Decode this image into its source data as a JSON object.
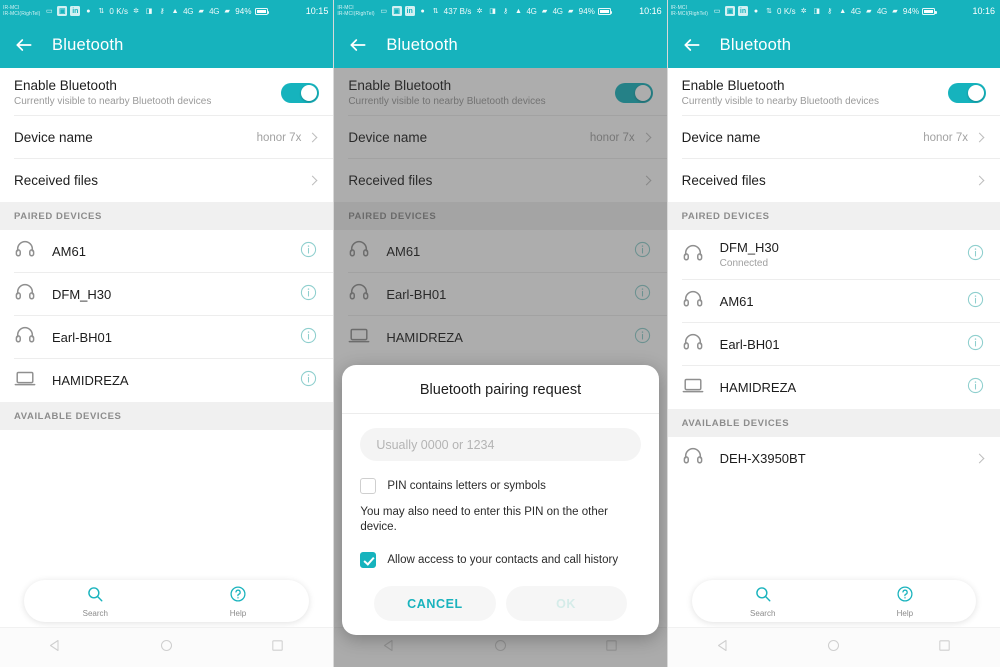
{
  "panels": [
    {
      "id": "panel-paired-list",
      "status": {
        "carrier_line1": "IR-MCI",
        "carrier_line2": "IR-MCI(RighTel)",
        "speed": "0 K/s",
        "battery": "94%",
        "time": "10:15",
        "signal_1": "4G",
        "signal_2": "4G"
      },
      "appbar": {
        "title": "Bluetooth",
        "back_icon": "back-arrow-icon"
      },
      "enable": {
        "title": "Enable Bluetooth",
        "subtitle": "Currently visible to nearby Bluetooth devices",
        "toggle_on": true
      },
      "device_name": {
        "label": "Device name",
        "value": "honor 7x"
      },
      "received_files": {
        "label": "Received files"
      },
      "paired_header": "PAIRED DEVICES",
      "paired": [
        {
          "name": "AM61",
          "state": "",
          "icon": "headphones-icon",
          "trailing": "info-icon"
        },
        {
          "name": "DFM_H30",
          "state": "",
          "icon": "headphones-icon",
          "trailing": "info-icon"
        },
        {
          "name": "Earl-BH01",
          "state": "",
          "icon": "headphones-icon",
          "trailing": "info-icon"
        },
        {
          "name": "HAMIDREZA",
          "state": "",
          "icon": "laptop-icon",
          "trailing": "info-icon"
        }
      ],
      "available_header": "AVAILABLE DEVICES",
      "available": [],
      "actions": [
        {
          "label": "Search",
          "icon": "search-icon"
        },
        {
          "label": "Help",
          "icon": "help-icon"
        }
      ],
      "dialog": null
    },
    {
      "id": "panel-pairing-dialog",
      "status": {
        "carrier_line1": "IR-MCI",
        "carrier_line2": "IR-MCI(RighTel)",
        "speed": "437 B/s",
        "battery": "94%",
        "time": "10:16",
        "signal_1": "4G",
        "signal_2": "4G"
      },
      "appbar": {
        "title": "Bluetooth",
        "back_icon": "back-arrow-icon"
      },
      "enable": {
        "title": "Enable Bluetooth",
        "subtitle": "Currently visible to nearby Bluetooth devices",
        "toggle_on": true
      },
      "device_name": {
        "label": "Device name",
        "value": "honor 7x"
      },
      "received_files": {
        "label": "Received files"
      },
      "paired_header": "PAIRED DEVICES",
      "paired": [
        {
          "name": "AM61",
          "state": "",
          "icon": "headphones-icon",
          "trailing": "info-icon"
        },
        {
          "name": "Earl-BH01",
          "state": "",
          "icon": "headphones-icon",
          "trailing": "info-icon"
        },
        {
          "name": "HAMIDREZA",
          "state": "",
          "icon": "laptop-icon",
          "trailing": "info-icon"
        }
      ],
      "available_header": "",
      "available": [],
      "actions": [],
      "dialog": {
        "title": "Bluetooth pairing request",
        "pin_placeholder": "Usually 0000 or 1234",
        "pin_value": "",
        "checkbox_letters": {
          "label": "PIN contains letters or symbols",
          "checked": false
        },
        "note": "You may also need to enter this PIN on the other device.",
        "checkbox_contacts": {
          "label": "Allow access to your contacts and call history",
          "checked": true
        },
        "cancel_label": "CANCEL",
        "ok_label": "OK",
        "ok_enabled": false
      }
    },
    {
      "id": "panel-connected-list",
      "status": {
        "carrier_line1": "IR-MCI",
        "carrier_line2": "IR-MCI(RighTel)",
        "speed": "0 K/s",
        "battery": "94%",
        "time": "10:16",
        "signal_1": "4G",
        "signal_2": "4G"
      },
      "appbar": {
        "title": "Bluetooth",
        "back_icon": "back-arrow-icon"
      },
      "enable": {
        "title": "Enable Bluetooth",
        "subtitle": "Currently visible to nearby Bluetooth devices",
        "toggle_on": true
      },
      "device_name": {
        "label": "Device name",
        "value": "honor 7x"
      },
      "received_files": {
        "label": "Received files"
      },
      "paired_header": "PAIRED DEVICES",
      "paired": [
        {
          "name": "DFM_H30",
          "state": "Connected",
          "icon": "headphones-icon",
          "trailing": "info-icon"
        },
        {
          "name": "AM61",
          "state": "",
          "icon": "headphones-icon",
          "trailing": "info-icon"
        },
        {
          "name": "Earl-BH01",
          "state": "",
          "icon": "headphones-icon",
          "trailing": "info-icon"
        },
        {
          "name": "HAMIDREZA",
          "state": "",
          "icon": "laptop-icon",
          "trailing": "info-icon"
        }
      ],
      "available_header": "AVAILABLE DEVICES",
      "available": [
        {
          "name": "DEH-X3950BT",
          "state": "",
          "icon": "headphones-icon",
          "trailing": "chevron-right-icon"
        }
      ],
      "actions": [
        {
          "label": "Search",
          "icon": "search-icon"
        },
        {
          "label": "Help",
          "icon": "help-icon"
        }
      ],
      "dialog": null
    }
  ],
  "navbar": {
    "back": "nav-back-icon",
    "home": "nav-home-icon",
    "recents": "nav-recents-icon"
  },
  "colors": {
    "accent": "#16b3bd",
    "section_bg": "#f0f0f0",
    "text_primary": "#1d1d1d",
    "text_secondary": "#9a9a9a"
  }
}
